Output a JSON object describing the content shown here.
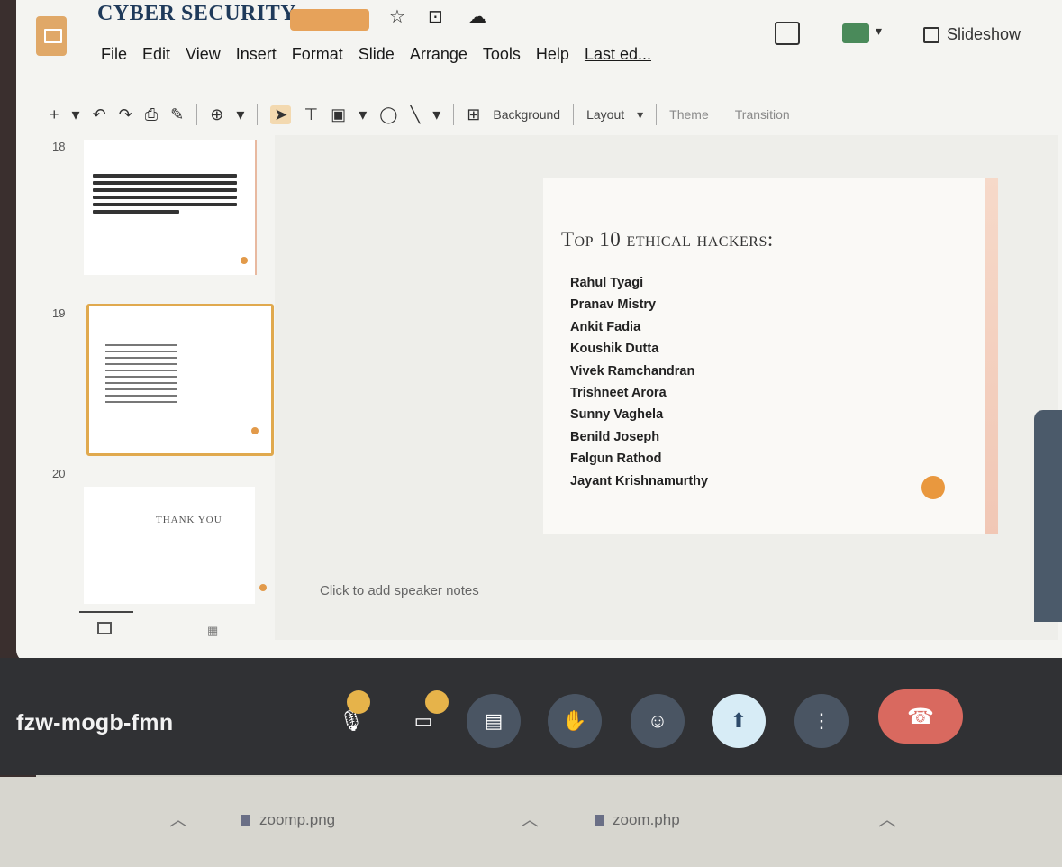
{
  "header": {
    "doc_title": "CYBER SECURITY",
    "menu": [
      "File",
      "Edit",
      "View",
      "Insert",
      "Format",
      "Slide",
      "Arrange",
      "Tools",
      "Help"
    ],
    "last_edit": "Last ed...",
    "slideshow_label": "Slideshow"
  },
  "toolbar": {
    "background_label": "Background",
    "layout_label": "Layout",
    "theme_label": "Theme",
    "transition_label": "Transition"
  },
  "filmstrip": {
    "slide_numbers": [
      "18",
      "19",
      "20"
    ],
    "slide20_text": "THANK YOU"
  },
  "slide": {
    "title": "Top 10 ethical hackers:",
    "items": [
      "Rahul Tyagi",
      "Pranav Mistry",
      "Ankit Fadia",
      "Koushik Dutta",
      "Vivek Ramchandran",
      "Trishneet Arora",
      "Sunny Vaghela",
      "Benild Joseph",
      "Falgun Rathod",
      "Jayant Krishnamurthy"
    ]
  },
  "notes": {
    "placeholder": "Click to add speaker notes"
  },
  "meet": {
    "meeting_code": "fzw-mogb-fmn"
  },
  "downloads": {
    "items": [
      "zoomp.png",
      "zoom.php"
    ]
  },
  "colors": {
    "accent_orange": "#e9983e",
    "callbar_bg": "#303134",
    "end_call_red": "#d9695f"
  }
}
